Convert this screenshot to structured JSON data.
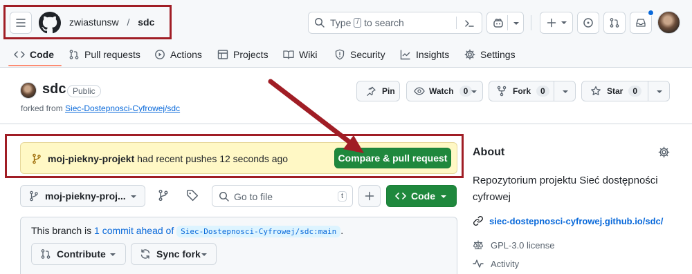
{
  "header": {
    "owner": "zwiastunsw",
    "separator": "/",
    "repo": "sdc",
    "search_placeholder": "Type",
    "search_key": "/",
    "search_suffix": "to search"
  },
  "tabs": [
    {
      "label": "Code"
    },
    {
      "label": "Pull requests"
    },
    {
      "label": "Actions"
    },
    {
      "label": "Projects"
    },
    {
      "label": "Wiki"
    },
    {
      "label": "Security"
    },
    {
      "label": "Insights"
    },
    {
      "label": "Settings"
    }
  ],
  "repo": {
    "name": "sdc",
    "visibility": "Public",
    "forked_prefix": "forked from",
    "forked_from": "Siec-Dostepnosci-Cyfrowej/sdc",
    "pin_label": "Pin",
    "watch_label": "Watch",
    "watch_count": "0",
    "fork_label": "Fork",
    "fork_count": "0",
    "star_label": "Star",
    "star_count": "0"
  },
  "banner": {
    "branch": "moj-piekny-projekt",
    "message": "had recent pushes 12 seconds ago",
    "button": "Compare & pull request"
  },
  "toolbar": {
    "branch_select": "moj-piekny-proj...",
    "goto_placeholder": "Go to file",
    "goto_key": "t",
    "code_button": "Code"
  },
  "branch_info": {
    "prefix": "This branch is",
    "link": "1 commit ahead of",
    "target": "Siec-Dostepnosci-Cyfrowej/sdc:main",
    "suffix": ".",
    "contribute": "Contribute",
    "sync": "Sync fork"
  },
  "about": {
    "title": "About",
    "description": "Repozytorium projektu Sieć dostępności cyfrowej",
    "link": "siec-dostepnosci-cyfrowej.github.io/sdc/",
    "license": "GPL-3.0 license",
    "activity": "Activity"
  },
  "colors": {
    "accent_green": "#1f883d",
    "link_blue": "#0969da",
    "annotation_red": "#a01d25",
    "banner_bg": "#fff8c5"
  }
}
